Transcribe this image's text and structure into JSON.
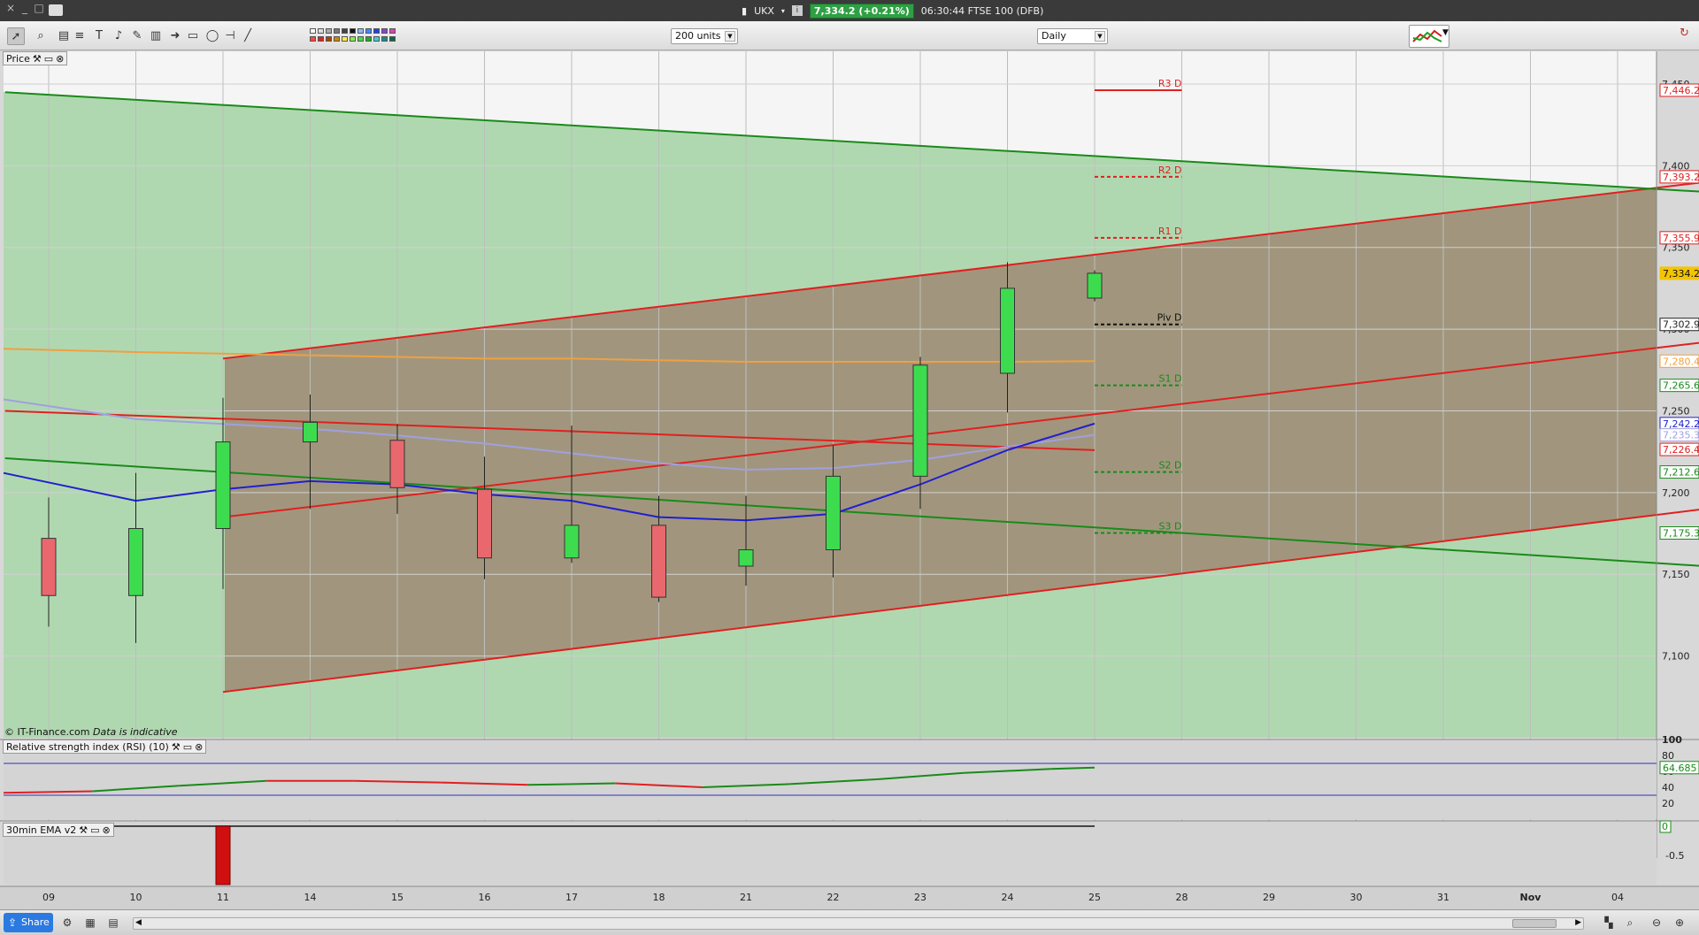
{
  "titlebar": {
    "symbol": "UKX",
    "price_change": "7,334.2 (+0.21%)",
    "time_instrument": "06:30:44 FTSE 100 (DFB)",
    "info_icon": "i"
  },
  "toolbar": {
    "units_select": "200 units",
    "period_select": "Daily"
  },
  "panes": {
    "price_label": "Price",
    "rsi_label": "Relative strength index (RSI) (10)",
    "ema_label": "30min EMA v2",
    "copyright": "© IT-Finance.com",
    "disclaimer": "Data is indicative"
  },
  "statusbar": {
    "share": "Share"
  },
  "colors": {
    "bull": "#3ddc4f",
    "bear": "#e8686e",
    "channel_fill": "#a08f78",
    "green_fill": "#b0d8b0",
    "resistance": "#e02020",
    "support": "#1a8a1a"
  },
  "chart_data": {
    "type": "candlestick",
    "x_tick_labels": [
      "09",
      "10",
      "11",
      "14",
      "15",
      "16",
      "17",
      "18",
      "21",
      "22",
      "23",
      "24",
      "25",
      "28",
      "29",
      "30",
      "31",
      "Nov",
      "04"
    ],
    "y_tick_labels": [
      "7,450",
      "7,400",
      "7,350",
      "7,300",
      "7,250",
      "7,200",
      "7,150",
      "7,100"
    ],
    "ylim": [
      7050,
      7470
    ],
    "candles": [
      {
        "date": "09",
        "open": 7172,
        "high": 7197,
        "low": 7118,
        "close": 7137
      },
      {
        "date": "10",
        "open": 7137,
        "high": 7212,
        "low": 7108,
        "close": 7178
      },
      {
        "date": "11",
        "open": 7178,
        "high": 7258,
        "low": 7141,
        "close": 7231
      },
      {
        "date": "14",
        "open": 7231,
        "high": 7260,
        "low": 7190,
        "close": 7243
      },
      {
        "date": "15",
        "open": 7232,
        "high": 7242,
        "low": 7187,
        "close": 7203
      },
      {
        "date": "16",
        "open": 7202,
        "high": 7222,
        "low": 7147,
        "close": 7160
      },
      {
        "date": "17",
        "open": 7160,
        "high": 7241,
        "low": 7157,
        "close": 7180
      },
      {
        "date": "18",
        "open": 7180,
        "high": 7198,
        "low": 7133,
        "close": 7136
      },
      {
        "date": "21",
        "open": 7155,
        "high": 7198,
        "low": 7143,
        "close": 7165
      },
      {
        "date": "22",
        "open": 7165,
        "high": 7229,
        "low": 7148,
        "close": 7210
      },
      {
        "date": "23",
        "open": 7210,
        "high": 7283,
        "low": 7190,
        "close": 7278
      },
      {
        "date": "24",
        "open": 7273,
        "high": 7341,
        "low": 7249,
        "close": 7325
      },
      {
        "date": "25",
        "open": 7319,
        "high": 7336,
        "low": 7317,
        "close": 7334.2
      }
    ],
    "price_markers": [
      {
        "label": "7,446.2",
        "value": 7446.2,
        "color": "#e02020"
      },
      {
        "label": "7,393.2",
        "value": 7393.2,
        "color": "#e02020"
      },
      {
        "label": "7,355.9",
        "value": 7355.9,
        "color": "#e02020"
      },
      {
        "label": "7,334.2",
        "value": 7334.2,
        "color": "#f4c400"
      },
      {
        "label": "7,302.9",
        "value": 7302.9,
        "color": "#222222"
      },
      {
        "label": "7,280.4",
        "value": 7280.4,
        "color": "#f0a040"
      },
      {
        "label": "7,265.6",
        "value": 7265.6,
        "color": "#1a8a1a"
      },
      {
        "label": "7,242.2",
        "value": 7242.2,
        "color": "#2020d0"
      },
      {
        "label": "7,235.3",
        "value": 7235.3,
        "color": "#a0a0e0"
      },
      {
        "label": "7,226.4",
        "value": 7226.4,
        "color": "#e02020"
      },
      {
        "label": "7,212.6",
        "value": 7212.6,
        "color": "#1a8a1a"
      },
      {
        "label": "7,175.3",
        "value": 7175.3,
        "color": "#1a8a1a"
      }
    ],
    "pivots": [
      {
        "label": "R3 D",
        "value": 7446.2,
        "color": "#e02020",
        "style": "solid"
      },
      {
        "label": "R2 D",
        "value": 7393.2,
        "color": "#e02020",
        "style": "dashed"
      },
      {
        "label": "R1 D",
        "value": 7355.9,
        "color": "#e02020",
        "style": "dashed"
      },
      {
        "label": "Piv D",
        "value": 7302.9,
        "color": "#111111",
        "style": "dashed"
      },
      {
        "label": "S1 D",
        "value": 7265.6,
        "color": "#1a8a1a",
        "style": "dashed"
      },
      {
        "label": "S2 D",
        "value": 7212.6,
        "color": "#1a8a1a",
        "style": "dashed"
      },
      {
        "label": "S3 D",
        "value": 7175.3,
        "color": "#1a8a1a",
        "style": "dashed"
      }
    ],
    "ma_orange": [
      7288,
      7286,
      7285,
      7284,
      7283,
      7282,
      7282,
      7281,
      7280,
      7280,
      7280,
      7280,
      7280.4
    ],
    "ma_lavender": [
      7257,
      7245,
      7242,
      7239,
      7235,
      7230,
      7224,
      7218,
      7214,
      7215,
      7220,
      7228,
      7235.3
    ],
    "ma_blue": [
      7212,
      7195,
      7202,
      7207,
      7205,
      7199,
      7195,
      7185,
      7183,
      7187,
      7205,
      7226,
      7242.2
    ],
    "trendlines": [
      {
        "color": "#e02020",
        "x0": 2,
        "y0": 7282,
        "x1": 19,
        "y1": 7390
      },
      {
        "color": "#e02020",
        "x0": 2,
        "y0": 7185,
        "x1": 19,
        "y1": 7292
      },
      {
        "color": "#e02020",
        "x0": 2,
        "y0": 7078,
        "x1": 19,
        "y1": 7190
      },
      {
        "color": "#e02020",
        "x0": -0.5,
        "y0": 7250,
        "x1": 12,
        "y1": 7226
      },
      {
        "color": "#1a8a1a",
        "x0": -0.5,
        "y0": 7445,
        "x1": 19,
        "y1": 7384
      },
      {
        "color": "#1a8a1a",
        "x0": -0.5,
        "y0": 7221,
        "x1": 19,
        "y1": 7155
      }
    ],
    "rsi": {
      "current_label": "64.685",
      "current": 64.685,
      "ylim": [
        0,
        100
      ],
      "y_tick_labels": [
        "100",
        "80",
        "60",
        "40",
        "20"
      ],
      "levels": [
        70,
        30
      ],
      "values": [
        33,
        35,
        42,
        48,
        48,
        46,
        43,
        45,
        40,
        44,
        50,
        58,
        63,
        64.685
      ],
      "value_colors": [
        "#e02020",
        "#1a8a1a",
        "#1a8a1a",
        "#e02020",
        "#e02020",
        "#e02020",
        "#1a8a1a",
        "#e02020",
        "#1a8a1a",
        "#1a8a1a",
        "#1a8a1a",
        "#1a8a1a",
        "#1a8a1a"
      ]
    },
    "ema": {
      "current_label": "0",
      "y_tick_labels": [
        "-0.5"
      ],
      "ylim": [
        -1,
        0
      ],
      "bars": [
        {
          "date": "11",
          "value": -1
        }
      ]
    }
  }
}
